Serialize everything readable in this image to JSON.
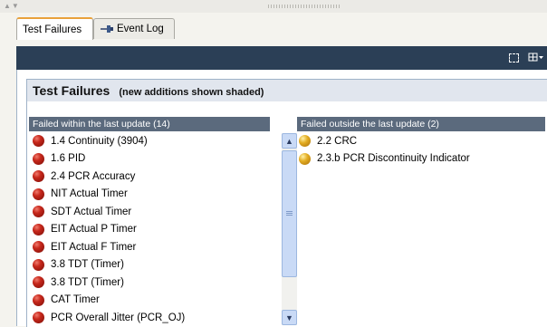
{
  "tabs": [
    {
      "label": "Test Failures",
      "active": true
    },
    {
      "label": "Event Log",
      "active": false,
      "icon": "pin-icon"
    }
  ],
  "toolbar": {
    "icons": [
      "select-region-icon",
      "view-menu-icon"
    ]
  },
  "panel": {
    "title": "Test Failures",
    "subtitle": "(new additions shown shaded)"
  },
  "left_list": {
    "header": "Failed within the last update (14)",
    "items": [
      "1.4 Continuity (3904)",
      "1.6 PID",
      "2.4 PCR Accuracy",
      "NIT Actual Timer",
      "SDT Actual Timer",
      "EIT Actual P Timer",
      "EIT Actual F Timer",
      "3.8 TDT (Timer)",
      "3.8 TDT (Timer)",
      "CAT Timer",
      "PCR Overall Jitter (PCR_OJ)"
    ],
    "status_color": "#c8281c"
  },
  "right_list": {
    "header": "Failed outside the last update (2)",
    "items": [
      "2.2 CRC",
      "2.3.b PCR Discontinuity Indicator"
    ],
    "status_color": "#e3ad23"
  },
  "colors": {
    "toolbar_bg": "#2b3f56",
    "header_bg": "#e1e6ee",
    "column_header_bg": "#5b6a7d",
    "active_tab_accent": "#e9a13b"
  }
}
